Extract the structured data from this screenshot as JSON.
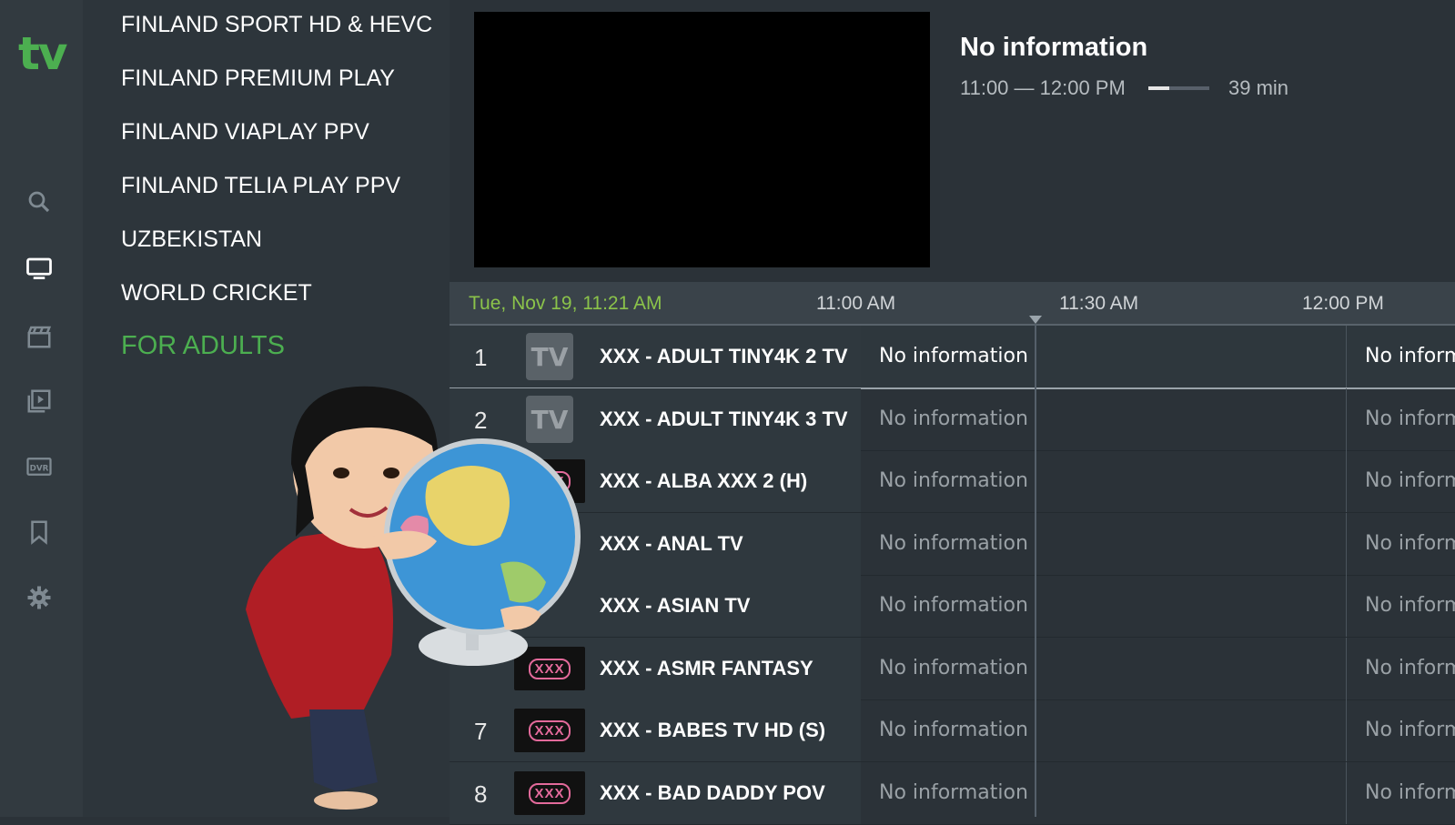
{
  "logo": "tv",
  "rail": {
    "items": [
      {
        "icon": "search-icon"
      },
      {
        "icon": "tv-icon",
        "active": true
      },
      {
        "icon": "clapperboard-icon"
      },
      {
        "icon": "play-library-icon"
      },
      {
        "icon": "dvr-icon",
        "label": "DVR"
      },
      {
        "icon": "bookmark-icon"
      },
      {
        "icon": "gear-icon"
      }
    ]
  },
  "groups": [
    {
      "label": "FINLAND SPORT HD & HEVC"
    },
    {
      "label": "FINLAND PREMIUM PLAY"
    },
    {
      "label": "FINLAND VIAPLAY PPV"
    },
    {
      "label": "FINLAND TELIA PLAY PPV"
    },
    {
      "label": "UZBEKISTAN"
    },
    {
      "label": "WORLD CRICKET"
    },
    {
      "label": "FOR ADULTS",
      "active": true
    }
  ],
  "info": {
    "title": "No information",
    "time": "11:00 — 12:00 PM",
    "progress": 0.35,
    "duration": "39 min"
  },
  "timeline": {
    "date": "Tue, Nov 19, 11:21 AM",
    "ticks": [
      "11:00 AM",
      "11:30 AM",
      "12:00 PM"
    ]
  },
  "channels": [
    {
      "num": "1",
      "logo": "TV",
      "logo_type": "tv",
      "name": "XXX - ADULT TINY4K 2 TV",
      "prog": "No information",
      "prog2": "No inform",
      "selected": true
    },
    {
      "num": "2",
      "logo": "TV",
      "logo_type": "tv",
      "name": "XXX - ADULT TINY4K 3 TV",
      "prog": "No information",
      "prog2": "No inform"
    },
    {
      "num": "",
      "logo": "XXX",
      "logo_type": "xxx",
      "name": "XXX - ALBA XXX 2 (H)",
      "prog": "No information",
      "prog2": "No inform"
    },
    {
      "num": "",
      "logo": "",
      "logo_type": "none",
      "name": "XXX - ANAL TV",
      "prog": "No information",
      "prog2": "No inform"
    },
    {
      "num": "",
      "logo": "",
      "logo_type": "none",
      "name": "XXX - ASIAN TV",
      "prog": "No information",
      "prog2": "No inform"
    },
    {
      "num": "",
      "logo": "XXX",
      "logo_type": "xxx",
      "name": "XXX - ASMR FANTASY",
      "prog": "No information",
      "prog2": "No inform"
    },
    {
      "num": "7",
      "logo": "XXX",
      "logo_type": "xxx",
      "name": "XXX - BABES TV HD (S)",
      "prog": "No information",
      "prog2": "No inform"
    },
    {
      "num": "8",
      "logo": "XXX",
      "logo_type": "xxx",
      "name": "XXX - BAD DADDY POV",
      "prog": "No information",
      "prog2": "No inform"
    }
  ],
  "colors": {
    "accent": "#4caf50",
    "background": "#2b3238",
    "sidebar": "#323a40"
  }
}
